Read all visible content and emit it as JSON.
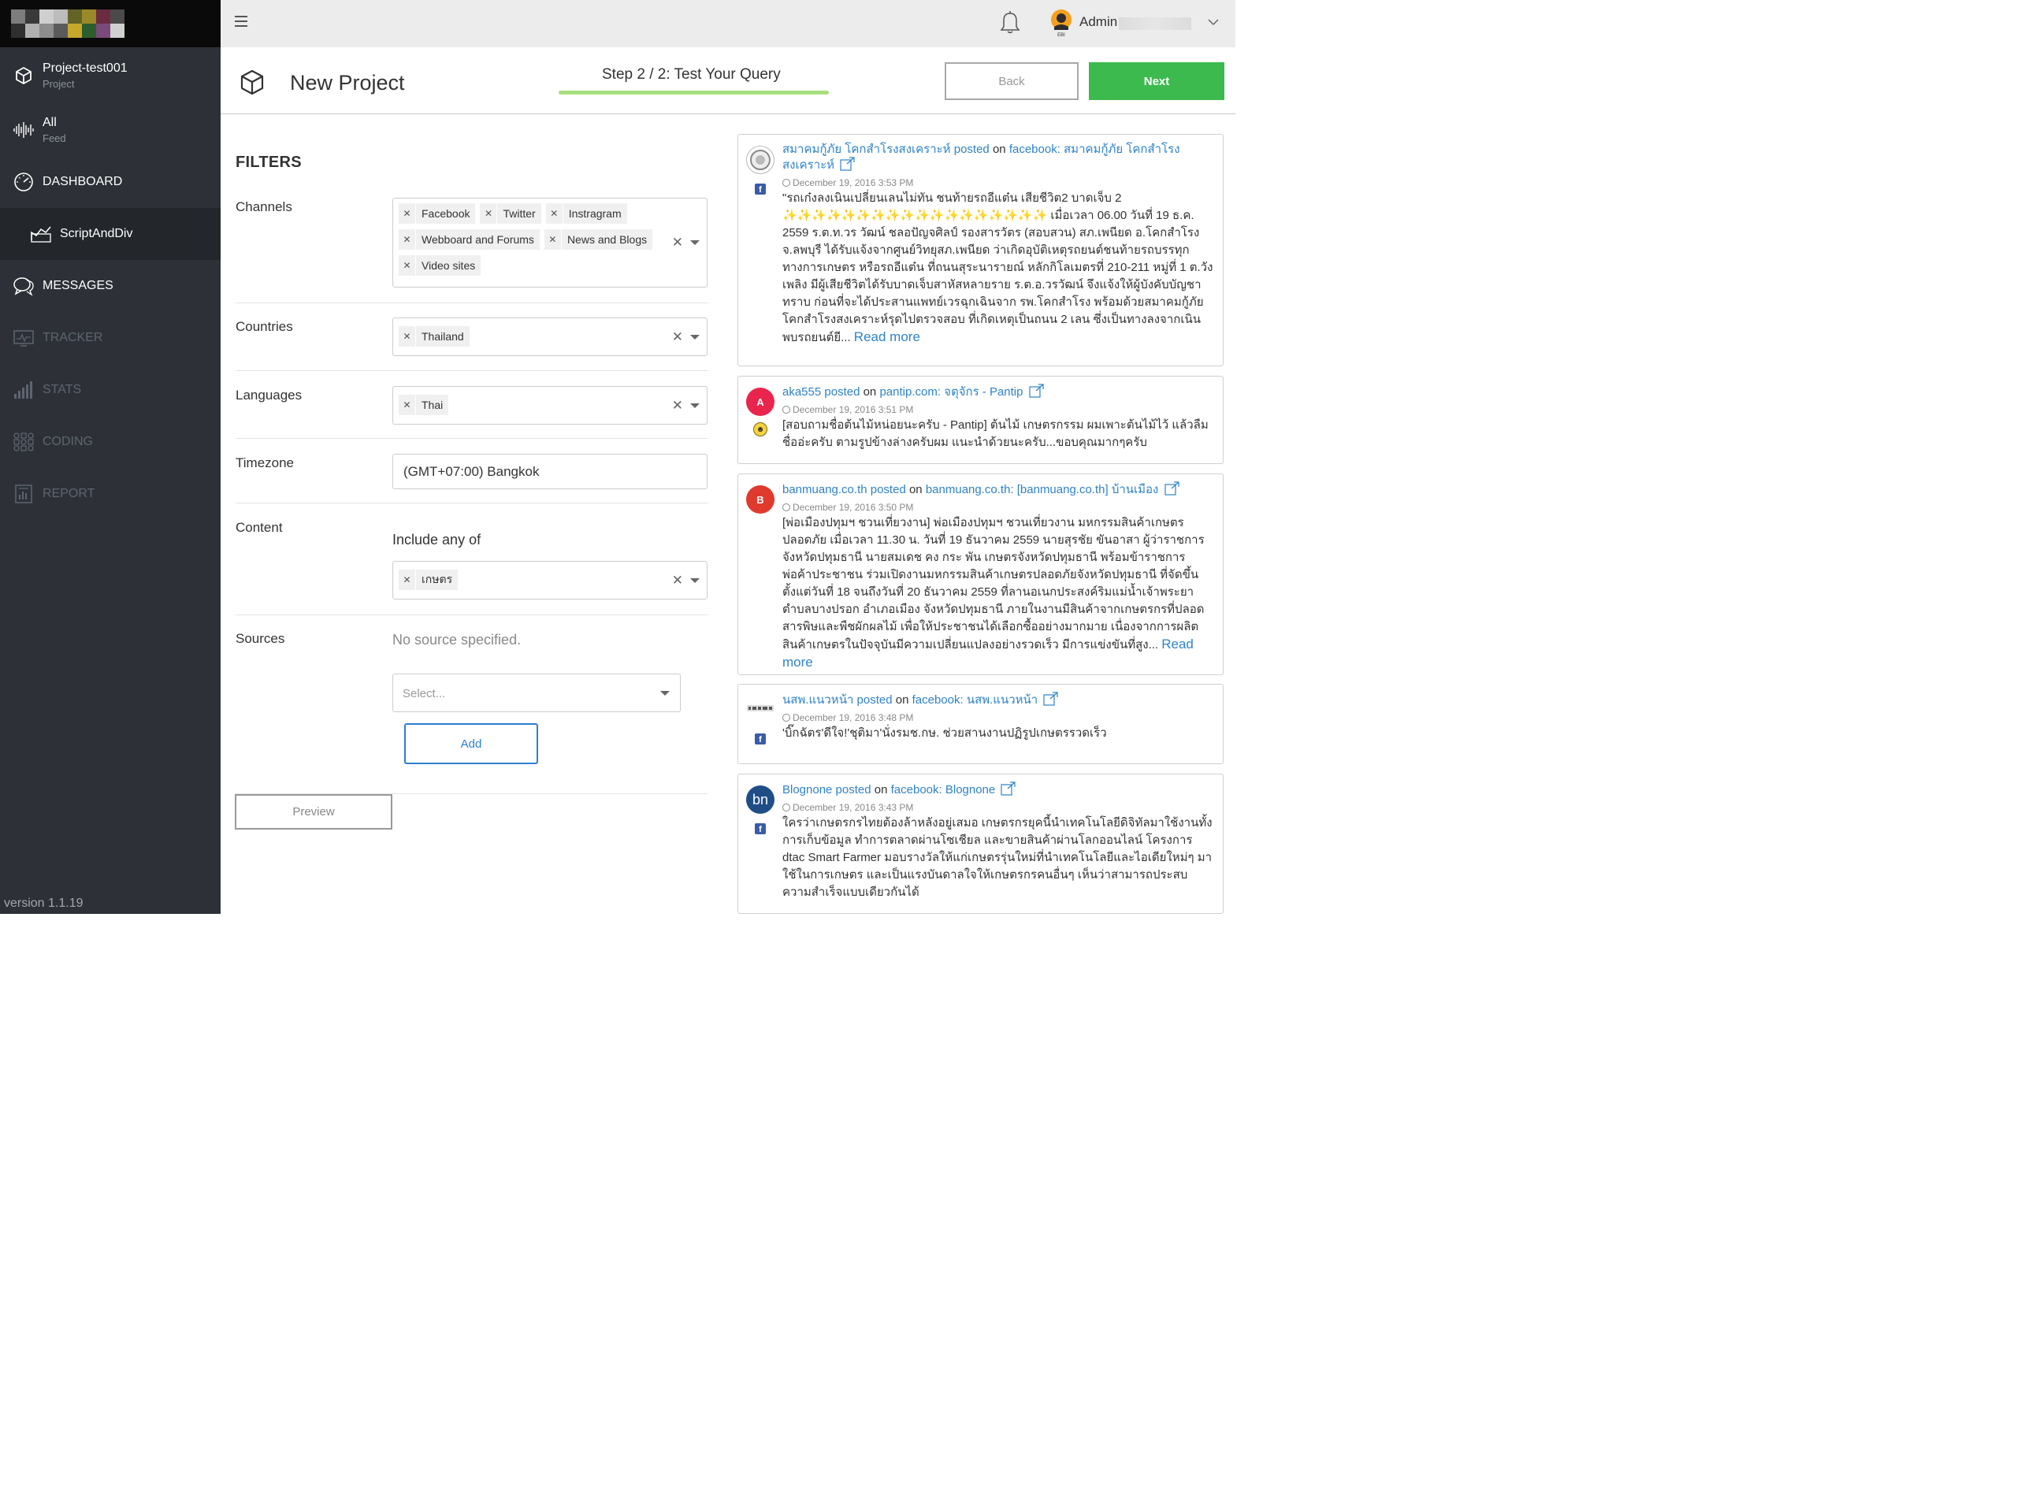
{
  "sidebar": {
    "logo_colors": [
      "#7d7d7d",
      "#3a3a3a",
      "#cfcfcf",
      "#bcbcbc",
      "#636327",
      "#9a8a27",
      "#6b2b40",
      "#4a4a4a",
      "#2f2f2f",
      "#b0b0b0",
      "#8d8d8d",
      "#5b5b5b",
      "#c5a82c",
      "#2d5d2d",
      "#7a4a7a",
      "#d0d0d0"
    ],
    "project": {
      "title": "Project-test001",
      "subtitle": "Project"
    },
    "feed": {
      "title": "All",
      "subtitle": "Feed"
    },
    "items": [
      {
        "label": "DASHBOARD",
        "icon": "gauge-icon"
      },
      {
        "label": "ScriptAndDiv",
        "icon": "chart-icon"
      },
      {
        "label": "MESSAGES",
        "icon": "chat-icon"
      },
      {
        "label": "TRACKER",
        "icon": "monitor-icon"
      },
      {
        "label": "STATS",
        "icon": "bars-icon"
      },
      {
        "label": "CODING",
        "icon": "grid-icon"
      },
      {
        "label": "REPORT",
        "icon": "report-icon"
      }
    ],
    "version": "version 1.1.19"
  },
  "topbar": {
    "user": "Admin"
  },
  "header": {
    "title": "New Project",
    "step": "Step 2 / 2: Test Your Query",
    "back": "Back",
    "next": "Next",
    "accent": "#3dba4e"
  },
  "filters": {
    "heading": "FILTERS",
    "channels_label": "Channels",
    "channels": [
      "Facebook",
      "Twitter",
      "Instragram",
      "Webboard and Forums",
      "News and Blogs",
      "Video sites"
    ],
    "countries_label": "Countries",
    "countries": [
      "Thailand"
    ],
    "languages_label": "Languages",
    "languages": [
      "Thai"
    ],
    "timezone_label": "Timezone",
    "timezone": "(GMT+07:00) Bangkok",
    "content_label": "Content",
    "include_label": "Include any of",
    "include_terms": [
      "เกษตร"
    ],
    "sources_label": "Sources",
    "sources_empty": "No source specified.",
    "select_placeholder": "Select...",
    "add": "Add",
    "preview": "Preview"
  },
  "feed": [
    {
      "poster": "สมาคมกู้ภัย โคกสำโรงสงเคราะห์ posted",
      "on": "on",
      "target": "facebook: สมาคมกู้ภัย โคกสำโรงสงเคราะห์",
      "date": "December 19, 2016 3:53 PM",
      "message": "\"รถเก๋งลงเนินเปลี่ยนเลนไม่ทัน ชนท้ายรถอีแต๋น เสียชีวิต2 บาดเจ็บ 2 ✨✨✨✨✨✨✨✨✨✨✨✨✨✨✨✨✨✨ เมื่อเวลา 06.00 วันที่ 19 ธ.ค. 2559 ร.ต.ท.วร วัฒน์ ชลอปัญจศิลป์ รองสารวัตร (สอบสวน) สภ.เพนียด อ.โคกสำโรง จ.ลพบุรี ได้รับแจ้งจากศูนย์วิทยุสภ.เพนียด ว่าเกิดอุบัติเหตุรถยนต์ชนท้ายรถบรรทุกทางการเกษตร หรือรถอีแต๋น ที่ถนนสุระนารายณ์ หลักกิโลเมตรที่ 210-211 หมู่ที่ 1 ต.วังเพลิง มีผู้เสียชีวิตได้รับบาดเจ็บสาหัสหลายราย ร.ต.อ.วรวัฒน์ จึงแจ้งให้ผู้บังคับบัญชาทราบ ก่อนที่จะได้ประสานแพทย์เวรฉุกเฉินจาก รพ.โคกสำโรง พร้อมด้วยสมาคมกู้ภัยโคกสำโรงสงเคราะห์รุดไปตรวจสอบ ที่เกิดเหตุเป็นถนน 2 เลน ซึ่งเป็นทางลงจากเนินพบรถยนต์ยี...",
      "readmore": "Read more",
      "avatar": "",
      "platform": "f"
    },
    {
      "poster": "aka555 posted",
      "on": "on",
      "target": "pantip.com: จตุจักร - Pantip",
      "date": "December 19, 2016 3:51 PM",
      "message": "[สอบถามชื่อต้นไม้หน่อยนะครับ - Pantip] ต้นไม้ เกษตรกรรม ผมเพาะต้นไม้ไว้ แล้วลืมชื่ออ่ะครับ ตามรูปข้างล่างครับผม แนะนำด้วยนะครับ...ขอบคุณมากๆครับ",
      "readmore": "",
      "avatar": "A",
      "platform": ""
    },
    {
      "poster": "banmuang.co.th posted",
      "on": "on",
      "target": "banmuang.co.th: [banmuang.co.th] บ้านเมือง",
      "date": "December 19, 2016 3:50 PM",
      "message": "[พ่อเมืองปทุมฯ ชวนเที่ยวงาน] พ่อเมืองปทุมฯ ชวนเที่ยวงาน มหกรรมสินค้าเกษตรปลอดภัย เมื่อเวลา 11.30 น. วันที่ 19 ธันวาคม 2559 นายสุรชัย ขันอาสา ผู้ว่าราชการจังหวัดปทุมธานี นายสมเดช คง กระ พัน เกษตรจังหวัดปทุมธานี พร้อมข้าราชการ พ่อค้าประชาชน ร่วมเปิดงานมหกรรมสินค้าเกษตรปลอดภัยจังหวัดปทุมธานี ที่จัดขึ้นตั้งแต่วันที่ 18 จนถึงวันที่ 20 ธันวาคม 2559 ที่ลานอเนกประสงค์ริมแม่น้ำเจ้าพระยา ตำบลบางปรอก อำเภอเมือง จังหวัดปทุมธานี ภายในงานมีสินค้าจากเกษตรกรที่ปลอดสารพิษและพืชผักผลไม้ เพื่อให้ประชาชนได้เลือกซื้ออย่างมากมาย เนื่องจากการผลิตสินค้าเกษตรในปัจจุบันมีความเปลี่ยนแปลงอย่างรวดเร็ว มีการแข่งขันที่สูง...",
      "readmore": "Read more",
      "avatar": "B",
      "platform": ""
    },
    {
      "poster": "นสพ.แนวหน้า posted",
      "on": "on",
      "target": "facebook: นสพ.แนวหน้า",
      "date": "December 19, 2016 3:48 PM",
      "message": "'บิ๊กฉัตร'ดีใจ!'ชุติมา'นั่งรมช.กษ. ช่วยสานงานปฏิรูปเกษตรรวดเร็ว",
      "readmore": "",
      "avatar": "",
      "platform": "f"
    },
    {
      "poster": "Blognone posted",
      "on": "on",
      "target": "facebook: Blognone",
      "date": "December 19, 2016 3:43 PM",
      "message": "ใครว่าเกษตรกรไทยต้องล้าหลังอยู่เสมอ เกษตรกรยุคนี้นำเทคโนโลยีดิจิทัลมาใช้งานทั้งการเก็บข้อมูล ทำการตลาดผ่านโซเชียล และขายสินค้าผ่านโลกออนไลน์ โครงการ dtac Smart Farmer มอบรางวัลให้แก่เกษตรรุ่นใหม่ที่นำเทคโนโลยีและไอเดียใหม่ๆ มาใช้ในการเกษตร และเป็นแรงบันดาลใจให้เกษตรกรคนอื่นๆ เห็นว่าสามารถประสบความสำเร็จแบบเดียวกันได้",
      "readmore": "",
      "avatar": "bn",
      "platform": "f"
    }
  ]
}
